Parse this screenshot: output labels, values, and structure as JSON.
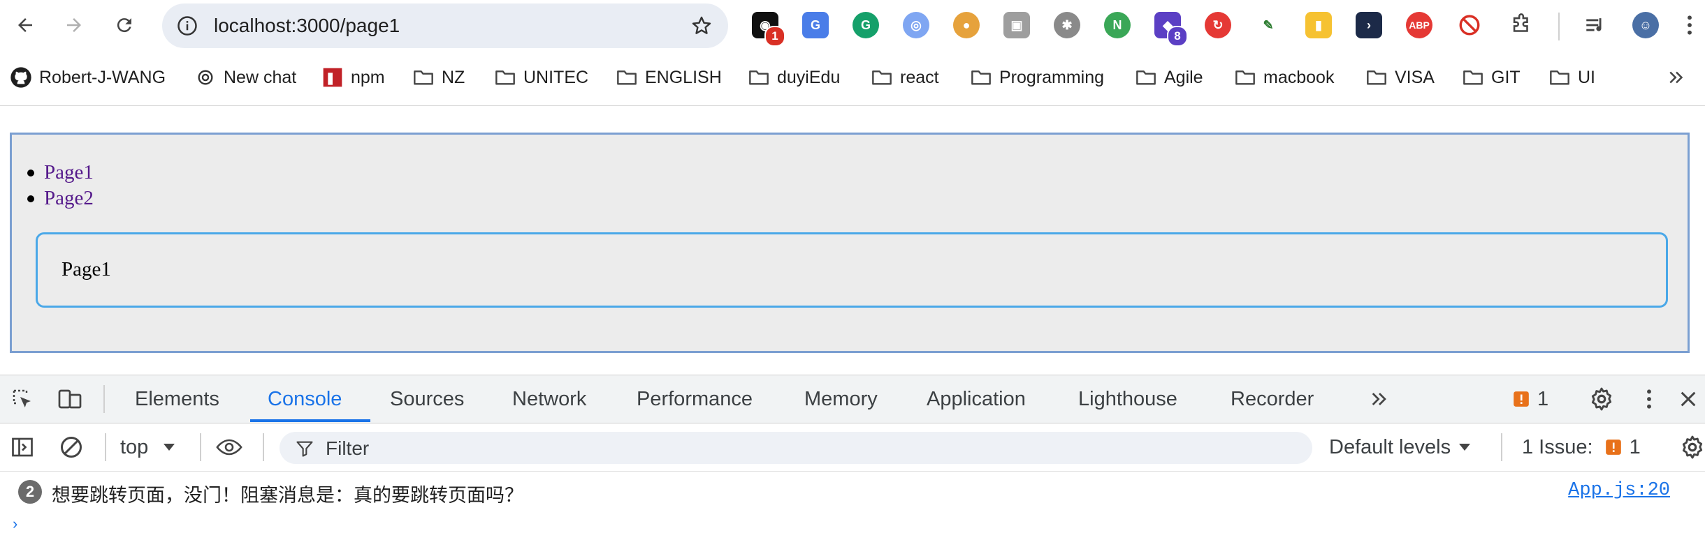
{
  "browser": {
    "url": "localhost:3000/page1",
    "extension_badges": {
      "ext1": "1",
      "ext2": "8"
    },
    "abp_label": "ABP"
  },
  "bookmarks": [
    {
      "label": "Robert-J-WANG",
      "icon": "github-icon"
    },
    {
      "label": "New chat",
      "icon": "openai-icon"
    },
    {
      "label": "npm",
      "icon": "npm-icon"
    },
    {
      "label": "NZ",
      "icon": "folder-icon"
    },
    {
      "label": "UNITEC",
      "icon": "folder-icon"
    },
    {
      "label": "ENGLISH",
      "icon": "folder-icon"
    },
    {
      "label": "duyiEdu",
      "icon": "folder-icon"
    },
    {
      "label": "react",
      "icon": "folder-icon"
    },
    {
      "label": "Programming",
      "icon": "folder-icon"
    },
    {
      "label": "Agile",
      "icon": "folder-icon"
    },
    {
      "label": "macbook",
      "icon": "folder-icon"
    },
    {
      "label": "VISA",
      "icon": "folder-icon"
    },
    {
      "label": "GIT",
      "icon": "folder-icon"
    },
    {
      "label": "UI",
      "icon": "folder-icon"
    }
  ],
  "app": {
    "nav_links": [
      "Page1",
      "Page2"
    ],
    "route_content": "Page1"
  },
  "devtools": {
    "tabs": [
      "Elements",
      "Console",
      "Sources",
      "Network",
      "Performance",
      "Memory",
      "Application",
      "Lighthouse",
      "Recorder"
    ],
    "active_tab": "Console",
    "issues_badge_count": "1",
    "context": "top",
    "filter_placeholder": "Filter",
    "levels": "Default levels",
    "issues_label": "1 Issue:",
    "issues_count": "1",
    "message": {
      "repeat_count": "2",
      "text": "想要跳转页面，没门！阻塞消息是：真的要跳转页面吗？",
      "source": "App.js:20"
    }
  },
  "colors": {
    "accent": "#1a73e8",
    "link_visited": "#551a8b",
    "route_border": "#4aa8e8",
    "app_border": "#7b9fd1"
  }
}
